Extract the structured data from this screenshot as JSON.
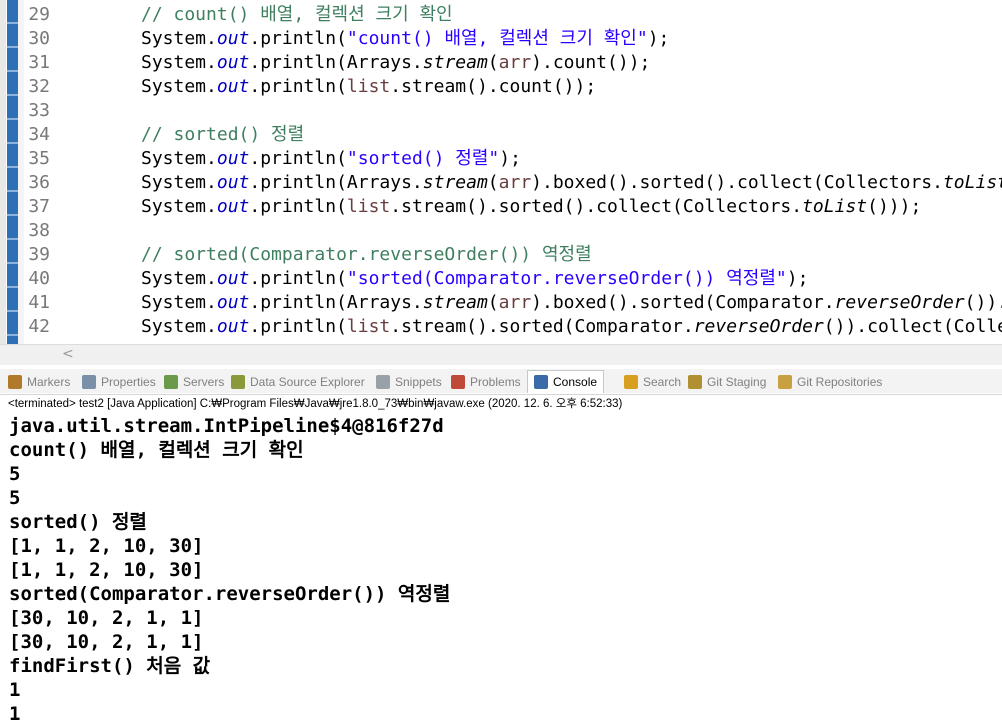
{
  "editor": {
    "lines": [
      {
        "num": "29",
        "parts": [
          {
            "t": "// count() 배열, 컬렉션 크기 확인",
            "c": "cmt"
          }
        ]
      },
      {
        "num": "30",
        "parts": [
          {
            "t": "System.",
            "c": ""
          },
          {
            "t": "out",
            "c": "fld"
          },
          {
            "t": ".println(",
            "c": ""
          },
          {
            "t": "\"count() 배열, 컬렉션 크기 확인\"",
            "c": "str"
          },
          {
            "t": ");",
            "c": ""
          }
        ]
      },
      {
        "num": "31",
        "parts": [
          {
            "t": "System.",
            "c": ""
          },
          {
            "t": "out",
            "c": "fld"
          },
          {
            "t": ".println(Arrays.",
            "c": ""
          },
          {
            "t": "stream",
            "c": "itl"
          },
          {
            "t": "(",
            "c": ""
          },
          {
            "t": "arr",
            "c": "var"
          },
          {
            "t": ").count());",
            "c": ""
          }
        ]
      },
      {
        "num": "32",
        "parts": [
          {
            "t": "System.",
            "c": ""
          },
          {
            "t": "out",
            "c": "fld"
          },
          {
            "t": ".println(",
            "c": ""
          },
          {
            "t": "list",
            "c": "var"
          },
          {
            "t": ".stream().count());",
            "c": ""
          }
        ]
      },
      {
        "num": "33",
        "parts": []
      },
      {
        "num": "34",
        "parts": [
          {
            "t": "// sorted() 정렬",
            "c": "cmt"
          }
        ]
      },
      {
        "num": "35",
        "parts": [
          {
            "t": "System.",
            "c": ""
          },
          {
            "t": "out",
            "c": "fld"
          },
          {
            "t": ".println(",
            "c": ""
          },
          {
            "t": "\"sorted() 정렬\"",
            "c": "str"
          },
          {
            "t": ");",
            "c": ""
          }
        ]
      },
      {
        "num": "36",
        "parts": [
          {
            "t": "System.",
            "c": ""
          },
          {
            "t": "out",
            "c": "fld"
          },
          {
            "t": ".println(Arrays.",
            "c": ""
          },
          {
            "t": "stream",
            "c": "itl"
          },
          {
            "t": "(",
            "c": ""
          },
          {
            "t": "arr",
            "c": "var"
          },
          {
            "t": ").boxed().sorted().collect(Collectors.",
            "c": ""
          },
          {
            "t": "toList",
            "c": "itl"
          },
          {
            "t": "()));",
            "c": ""
          }
        ]
      },
      {
        "num": "37",
        "parts": [
          {
            "t": "System.",
            "c": ""
          },
          {
            "t": "out",
            "c": "fld"
          },
          {
            "t": ".println(",
            "c": ""
          },
          {
            "t": "list",
            "c": "var"
          },
          {
            "t": ".stream().sorted().collect(Collectors.",
            "c": ""
          },
          {
            "t": "toList",
            "c": "itl"
          },
          {
            "t": "()));",
            "c": ""
          }
        ]
      },
      {
        "num": "38",
        "parts": []
      },
      {
        "num": "39",
        "parts": [
          {
            "t": "// sorted(Comparator.reverseOrder()) 역정렬",
            "c": "cmt"
          }
        ]
      },
      {
        "num": "40",
        "parts": [
          {
            "t": "System.",
            "c": ""
          },
          {
            "t": "out",
            "c": "fld"
          },
          {
            "t": ".println(",
            "c": ""
          },
          {
            "t": "\"sorted(Comparator.reverseOrder()) 역정렬\"",
            "c": "str"
          },
          {
            "t": ");",
            "c": ""
          }
        ]
      },
      {
        "num": "41",
        "parts": [
          {
            "t": "System.",
            "c": ""
          },
          {
            "t": "out",
            "c": "fld"
          },
          {
            "t": ".println(Arrays.",
            "c": ""
          },
          {
            "t": "stream",
            "c": "itl"
          },
          {
            "t": "(",
            "c": ""
          },
          {
            "t": "arr",
            "c": "var"
          },
          {
            "t": ").boxed().sorted(Comparator.",
            "c": ""
          },
          {
            "t": "reverseOrder",
            "c": "itl"
          },
          {
            "t": "()).collec",
            "c": ""
          }
        ]
      },
      {
        "num": "42",
        "parts": [
          {
            "t": "System.",
            "c": ""
          },
          {
            "t": "out",
            "c": "fld"
          },
          {
            "t": ".println(",
            "c": ""
          },
          {
            "t": "list",
            "c": "var"
          },
          {
            "t": ".stream().sorted(Comparator.",
            "c": ""
          },
          {
            "t": "reverseOrder",
            "c": "itl"
          },
          {
            "t": "()).collect(Collectors.",
            "c": ""
          }
        ]
      }
    ],
    "scroll_arrow": "<"
  },
  "tabs": [
    {
      "label": "Markers",
      "icon": "markers-icon",
      "color": "#b07a2a"
    },
    {
      "label": "Properties",
      "icon": "properties-icon",
      "color": "#7a8fa8"
    },
    {
      "label": "Servers",
      "icon": "servers-icon",
      "color": "#6a9a4a"
    },
    {
      "label": "Data Source Explorer",
      "icon": "database-icon",
      "color": "#8a9a3a"
    },
    {
      "label": "Snippets",
      "icon": "snippets-icon",
      "color": "#9aa0a8"
    },
    {
      "label": "Problems",
      "icon": "problems-icon",
      "color": "#c04a3a"
    },
    {
      "label": "Console",
      "icon": "console-icon",
      "color": "#3a6aa8",
      "active": true
    },
    {
      "label": "Search",
      "icon": "search-icon",
      "color": "#d8a020"
    },
    {
      "label": "Git Staging",
      "icon": "git-staging-icon",
      "color": "#b09030"
    },
    {
      "label": "Git Repositories",
      "icon": "git-repositories-icon",
      "color": "#c8a040"
    }
  ],
  "status": "<terminated> test2 [Java Application] C:₩Program Files₩Java₩jre1.8.0_73₩bin₩javaw.exe (2020. 12. 6. 오후 6:52:33)",
  "console": [
    "java.util.stream.IntPipeline$4@816f27d",
    "count() 배열, 컬렉션 크기 확인",
    "5",
    "5",
    "sorted() 정렬",
    "[1, 1, 2, 10, 30]",
    "[1, 1, 2, 10, 30]",
    "sorted(Comparator.reverseOrder()) 역정렬",
    "[30, 10, 2, 1, 1]",
    "[30, 10, 2, 1, 1]",
    "findFirst() 처음 값",
    "1",
    "1"
  ]
}
